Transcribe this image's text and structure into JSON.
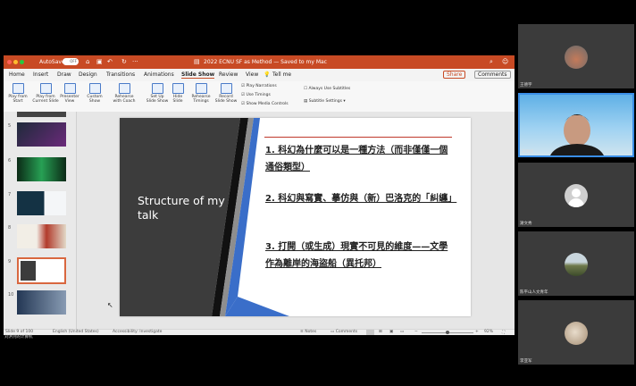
{
  "window": {
    "autosave_label": "AutoSave",
    "autosave_state": "OFF",
    "title": "2022 ECNU SF as Method — Saved to my Mac"
  },
  "tabs": [
    "Home",
    "Insert",
    "Draw",
    "Design",
    "Transitions",
    "Animations",
    "Slide Show",
    "Review",
    "View"
  ],
  "tell_me": "Tell me",
  "share_label": "Share",
  "comments_label": "Comments",
  "ribbon": {
    "buttons": [
      {
        "l1": "Play from",
        "l2": "Start"
      },
      {
        "l1": "Play from",
        "l2": "Current Slide"
      },
      {
        "l1": "Presenter",
        "l2": "View"
      },
      {
        "l1": "Custom",
        "l2": "Show"
      },
      {
        "l1": "Rehearse",
        "l2": "with Coach"
      },
      {
        "l1": "Set Up",
        "l2": "Slide Show"
      },
      {
        "l1": "Hide",
        "l2": "Slide"
      },
      {
        "l1": "Rehearse",
        "l2": "Timings"
      },
      {
        "l1": "Record",
        "l2": "Slide Show"
      }
    ],
    "checkboxes": [
      "Play Narrations",
      "Use Timings",
      "Show Media Controls"
    ],
    "always_subtitles": "Always Use Subtitles",
    "subtitle_settings": "Subtitle Settings"
  },
  "thumbnail_numbers": [
    "5",
    "6",
    "7",
    "8",
    "9",
    "10"
  ],
  "slide": {
    "title": "Structure of my talk",
    "points": [
      "1. 科幻為什麼可以是一種方法（而非僅僅一個通俗類型）",
      "2. 科幻與寫實、摹仿與（新）巴洛克的「糾纏」",
      "3. 打開（或生成）現實不可見的維度——文學作為離岸的海盜船（異托邦）"
    ]
  },
  "status": {
    "slide_of": "Slide 9 of 100",
    "language": "English (United States)",
    "accessibility": "Accessibility: Investigate",
    "notes": "Notes",
    "comments": "Comments",
    "zoom": "92%"
  },
  "presenter_label": "刘洪冽的计算机",
  "participants": [
    {
      "name": "王德宇"
    },
    {
      "name": "宋明炜"
    },
    {
      "name": "謝文秀"
    },
    {
      "name": "陈平山人文青年"
    },
    {
      "name": "李亚军"
    }
  ],
  "colors": {
    "titlebar": "#c84a24",
    "slide_dark_panel": "#3c3c3c",
    "slide_accent_blue": "#3a6ec9",
    "slide_rule_red": "#c0392b"
  }
}
